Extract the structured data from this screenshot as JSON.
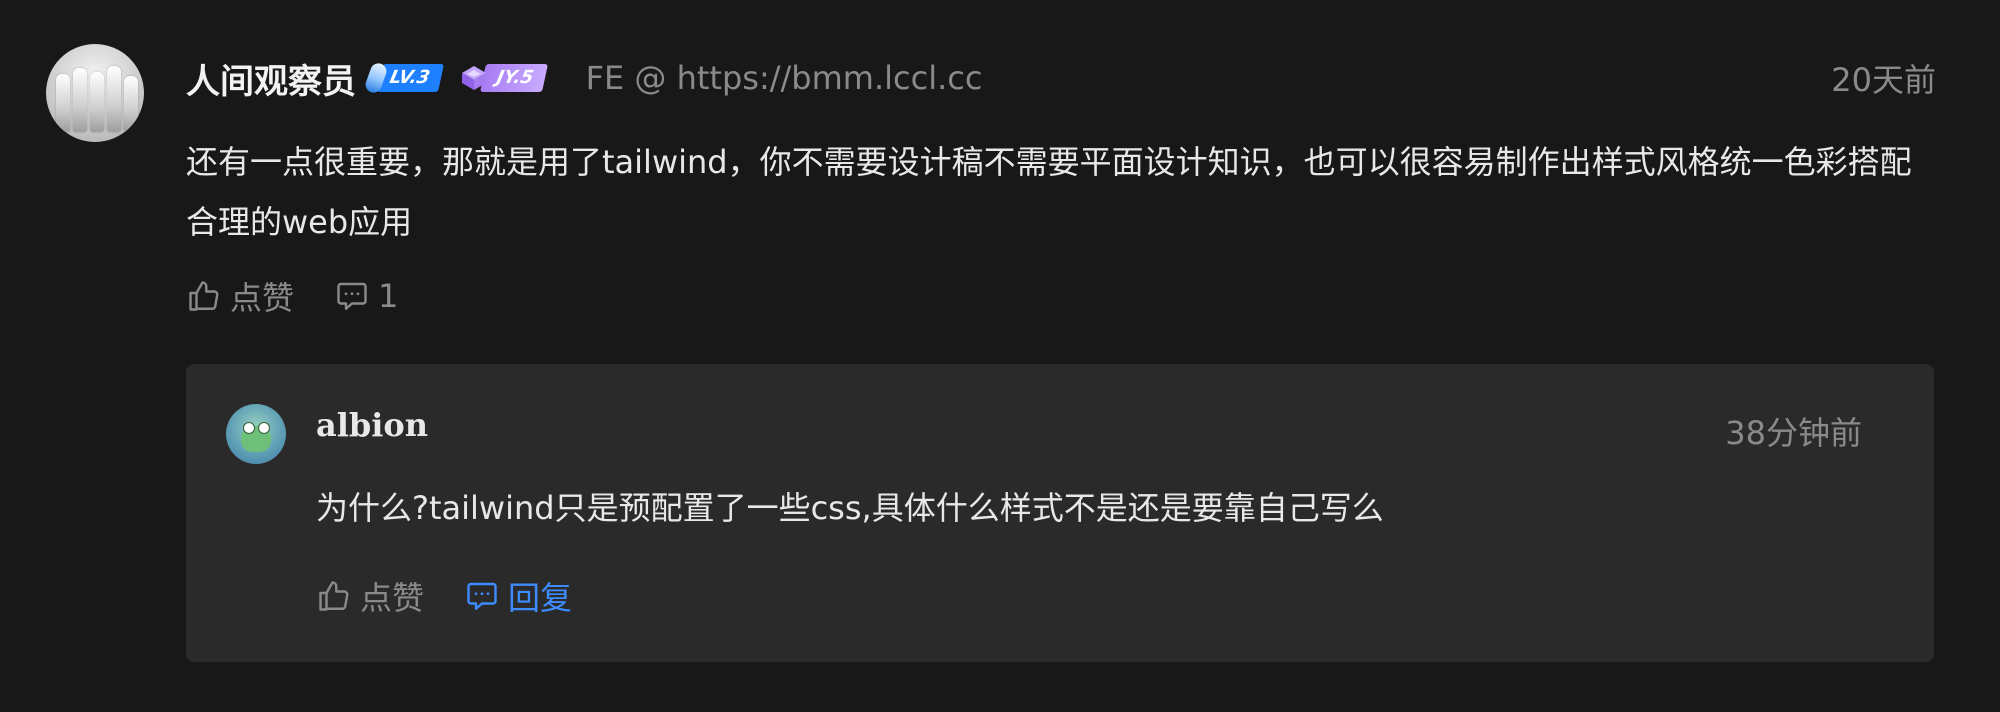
{
  "comment": {
    "author": "人间观察员",
    "level_badge": "LV.3",
    "jy_badge": "JY.5",
    "user_desc": "FE @ https://bmm.lccl.cc",
    "time": "20天前",
    "content": "还有一点很重要，那就是用了tailwind，你不需要设计稿不需要平面设计知识，也可以很容易制作出样式风格统一色彩搭配合理的web应用",
    "like_label": "点赞",
    "reply_count": "1"
  },
  "reply": {
    "author": "albion",
    "time": "38分钟前",
    "content": "为什么?tailwind只是预配置了一些css,具体什么样式不是还是要靠自己写么",
    "like_label": "点赞",
    "reply_label": "回复"
  },
  "colors": {
    "background": "#181818",
    "reply_background": "#2a2a2a",
    "muted_text": "#8a8a8a",
    "accent": "#3d8bff",
    "lv_badge": "#1e80ff",
    "jy_badge": "#a77cf3"
  },
  "icons": [
    "thumbs-up-icon",
    "comment-icon",
    "level-icon",
    "jy-gem-icon"
  ]
}
